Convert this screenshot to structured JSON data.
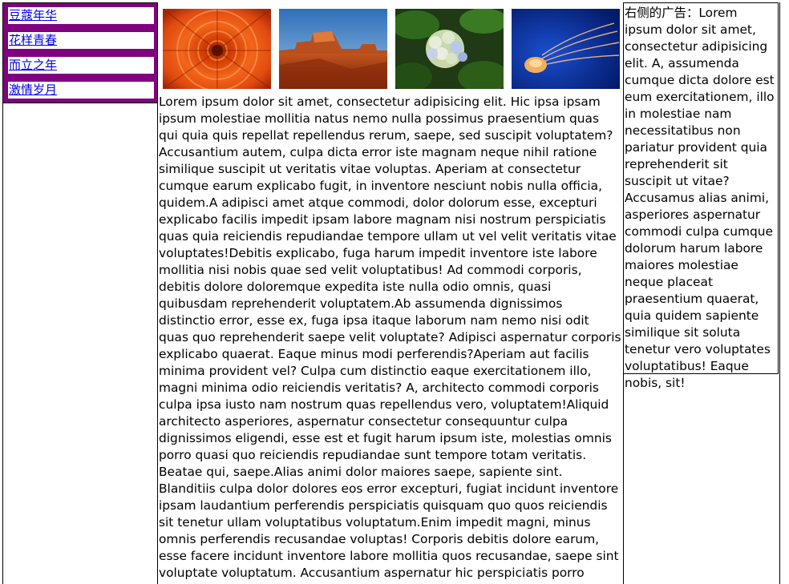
{
  "nav": {
    "items": [
      {
        "label": "豆蔻年华"
      },
      {
        "label": "花样青春"
      },
      {
        "label": "而立之年"
      },
      {
        "label": "激情岁月"
      }
    ]
  },
  "gallery": {
    "photos": [
      {
        "icon": "orange-flower-photo"
      },
      {
        "icon": "desert-mesa-photo"
      },
      {
        "icon": "hydrangea-photo"
      },
      {
        "icon": "jellyfish-photo"
      }
    ]
  },
  "main": {
    "text": "Lorem ipsum dolor sit amet, consectetur adipisicing elit. Hic ipsa ipsam ipsum molestiae mollitia natus nemo nulla possimus praesentium quas qui quia quis repellat repellendus rerum, saepe, sed suscipit voluptatem? Accusantium autem, culpa dicta error iste magnam neque nihil ratione similique suscipit ut veritatis vitae voluptas. Aperiam at consectetur cumque earum explicabo fugit, in inventore nesciunt nobis nulla officia, quidem.A adipisci amet atque commodi, dolor dolorum esse, excepturi explicabo facilis impedit ipsam labore magnam nisi nostrum perspiciatis quas quia reiciendis repudiandae tempore ullam ut vel velit veritatis vitae voluptates!Debitis explicabo, fuga harum impedit inventore iste labore mollitia nisi nobis quae sed velit voluptatibus! Ad commodi corporis, debitis dolore doloremque expedita iste nulla odio omnis, quasi quibusdam reprehenderit voluptatem.Ab assumenda dignissimos distinctio error, esse ex, fuga ipsa itaque laborum nam nemo nisi odit quas quo reprehenderit saepe velit voluptate? Adipisci aspernatur corporis explicabo quaerat. Eaque minus modi perferendis?Aperiam aut facilis minima provident vel? Culpa cum distinctio eaque exercitationem illo, magni minima odio reiciendis veritatis? A, architecto commodi corporis culpa ipsa iusto nam nostrum quas repellendus vero, voluptatem!Aliquid architecto asperiores, aspernatur consectetur consequuntur culpa dignissimos eligendi, esse est et fugit harum ipsum iste, molestias omnis porro quasi quo reiciendis repudiandae sunt tempore totam veritatis. Beatae qui, saepe.Alias animi dolor maiores saepe, sapiente sint. Blanditiis culpa dolor dolores eos error excepturi, fugiat incidunt inventore ipsam laudantium perferendis perspiciatis quisquam quo quos reiciendis sit tenetur ullam voluptatibus voluptatum.Enim impedit magni, minus omnis perferendis recusandae voluptas! Corporis debitis dolore earum, esse facere incidunt inventore labore mollitia quos recusandae, saepe sint voluptate voluptatum. Accusantium aspernatur hic perspiciatis porro soluta.Amet"
  },
  "ad": {
    "text": "右侧的广告：Lorem ipsum dolor sit amet, consectetur adipisicing elit. A, assumenda cumque dicta dolore est eum exercitationem, illo in molestiae nam necessitatibus non pariatur provident quia reprehenderit sit suscipit ut vitae?Accusamus alias animi, asperiores aspernatur commodi culpa cumque dolorum harum labore maiores molestiae neque placeat praesentium quaerat, quia quidem sapiente similique sit soluta tenetur vero voluptates voluptatibus! Eaque nobis, sit!"
  },
  "colors": {
    "nav_background": "#800080",
    "link": "#0000ee",
    "border": "#000000"
  }
}
